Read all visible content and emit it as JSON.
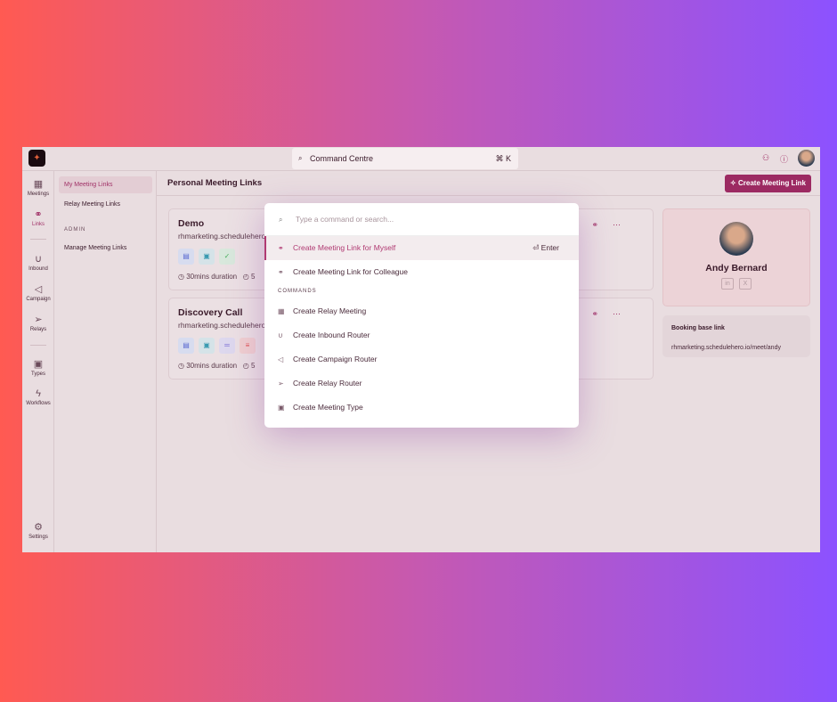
{
  "topbar": {
    "command_label": "Command Centre",
    "shortcut": "⌘ K"
  },
  "rail": [
    {
      "label": "Meetings",
      "icon": "calendar-icon"
    },
    {
      "label": "Links",
      "icon": "link-icon",
      "active": true
    },
    {
      "label": "Inbound",
      "icon": "magnet-icon"
    },
    {
      "label": "Campaign",
      "icon": "megaphone-icon"
    },
    {
      "label": "Relays",
      "icon": "relay-icon"
    },
    {
      "label": "Types",
      "icon": "video-icon"
    },
    {
      "label": "Workflows",
      "icon": "bolt-icon"
    },
    {
      "label": "Settings",
      "icon": "gear-icon"
    }
  ],
  "subnav": {
    "items": [
      "My Meeting Links",
      "Relay Meeting Links"
    ],
    "admin_label": "ADMIN",
    "admin_items": [
      "Manage Meeting Links"
    ]
  },
  "main": {
    "title": "Personal Meeting Links",
    "create_button": "Create Meeting Link",
    "cards": [
      {
        "title": "Demo",
        "url": "rhmarketing.schedulehero",
        "duration": "30mins duration",
        "extra": "5"
      },
      {
        "title": "Discovery Call",
        "url": "rhmarketing.schedulehero",
        "duration": "30mins duration",
        "extra": "5"
      }
    ]
  },
  "profile": {
    "name": "Andy Bernard",
    "booking_label": "Booking base link",
    "booking_url": "rhmarketing.schedulehero.io/meet/andy"
  },
  "modal": {
    "placeholder": "Type a command or search...",
    "enter_hint": "Enter",
    "top_items": [
      "Create Meeting Link for Myself",
      "Create Meeting Link for Colleague"
    ],
    "section": "COMMANDS",
    "commands": [
      "Create Relay Meeting",
      "Create Inbound Router",
      "Create Campaign Router",
      "Create Relay Router",
      "Create Meeting Type"
    ]
  },
  "colors": {
    "accent": "#9c2a62",
    "selected_text": "#b03a72"
  }
}
